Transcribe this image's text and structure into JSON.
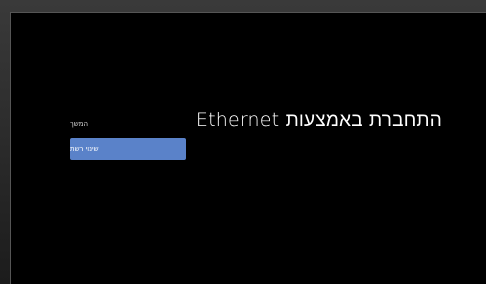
{
  "screen": {
    "title": "התחברת באמצעות Ethernet"
  },
  "options": {
    "continue_label": "המשך",
    "change_network_label": "שינוי רשת"
  },
  "colors": {
    "screen_background": "#000000",
    "focused_option": "#5a82c9",
    "text": "#ffffff"
  }
}
